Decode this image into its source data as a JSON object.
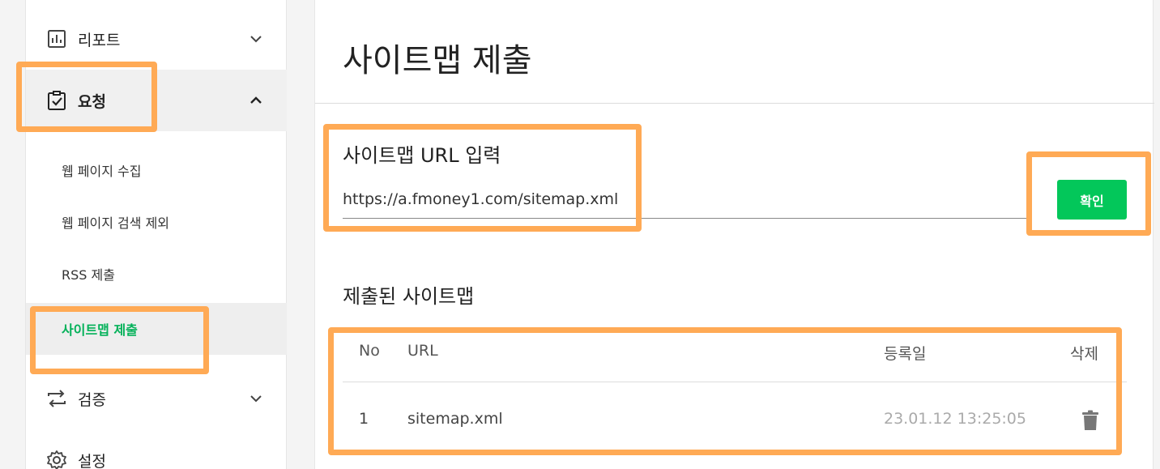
{
  "sidebar": {
    "items": [
      {
        "label": "리포트",
        "icon": "report-icon",
        "expanded": false
      },
      {
        "label": "요청",
        "icon": "clipboard-check-icon",
        "expanded": true
      },
      {
        "label": "검증",
        "icon": "repeat-icon",
        "expanded": false
      },
      {
        "label": "설정",
        "icon": "gear-icon"
      }
    ],
    "sub_items": [
      {
        "label": "웹 페이지 수집"
      },
      {
        "label": "웹 페이지 검색 제외"
      },
      {
        "label": "RSS 제출"
      },
      {
        "label": "사이트맵 제출",
        "active": true
      }
    ]
  },
  "main": {
    "title": "사이트맵 제출",
    "url_label": "사이트맵 URL 입력",
    "url_value": "https://a.fmoney1.com/sitemap.xml",
    "confirm_label": "확인",
    "submitted_title": "제출된 사이트맵",
    "table": {
      "headers": {
        "no": "No",
        "url": "URL",
        "date": "등록일",
        "delete": "삭제"
      },
      "rows": [
        {
          "no": "1",
          "url": "sitemap.xml",
          "date": "23.01.12 13:25:05"
        }
      ]
    }
  },
  "colors": {
    "accent_green": "#03c75a",
    "active_text_green": "#03b159",
    "highlight_orange": "#ffaa55"
  }
}
